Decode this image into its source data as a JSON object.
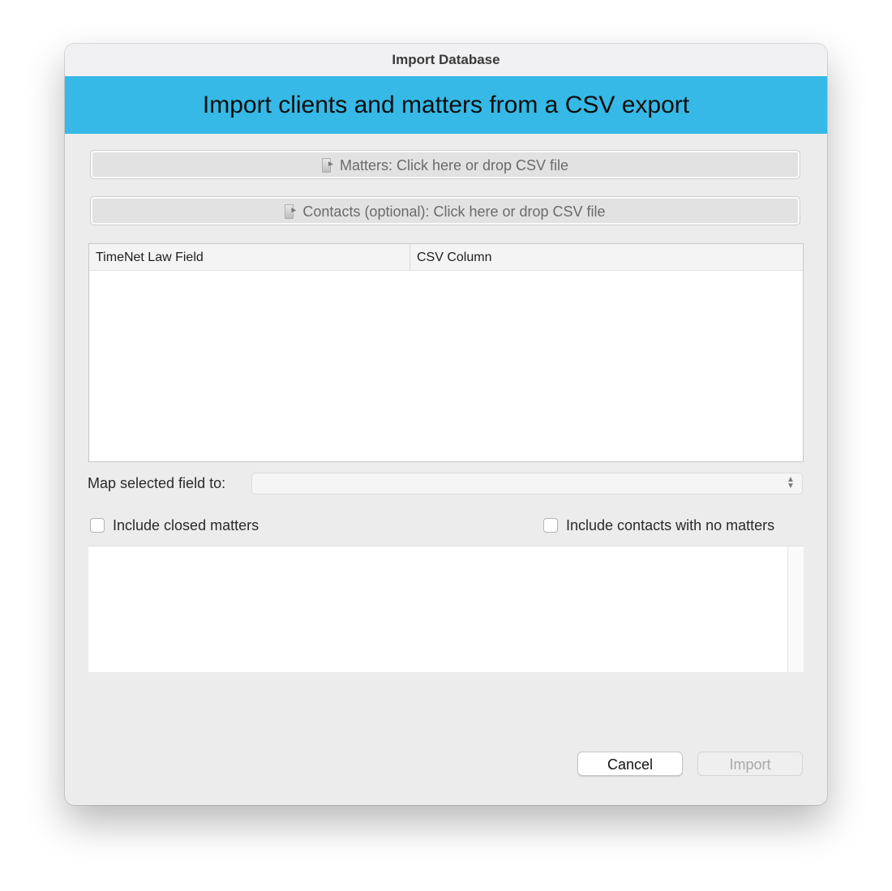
{
  "window": {
    "title": "Import Database"
  },
  "banner": {
    "heading": "Import clients and matters from a CSV export"
  },
  "drop_zones": {
    "matters_label": "Matters: Click here or drop CSV file",
    "contacts_label": "Contacts (optional): Click here or drop CSV file"
  },
  "mapping_table": {
    "columns": [
      "TimeNet Law Field",
      "CSV Column"
    ],
    "rows": []
  },
  "map_field": {
    "label": "Map selected field to:",
    "selected_value": ""
  },
  "options": {
    "include_closed_matters": {
      "label": "Include closed matters",
      "checked": false
    },
    "include_contacts_no_matters": {
      "label": "Include contacts with no matters",
      "checked": false
    }
  },
  "footer": {
    "cancel_label": "Cancel",
    "import_label": "Import"
  },
  "colors": {
    "banner": "#36b9e6",
    "window_bg": "#ececec"
  },
  "icons": {
    "drop_zone": "document-icon",
    "select": "up-down-chevron-icon"
  }
}
